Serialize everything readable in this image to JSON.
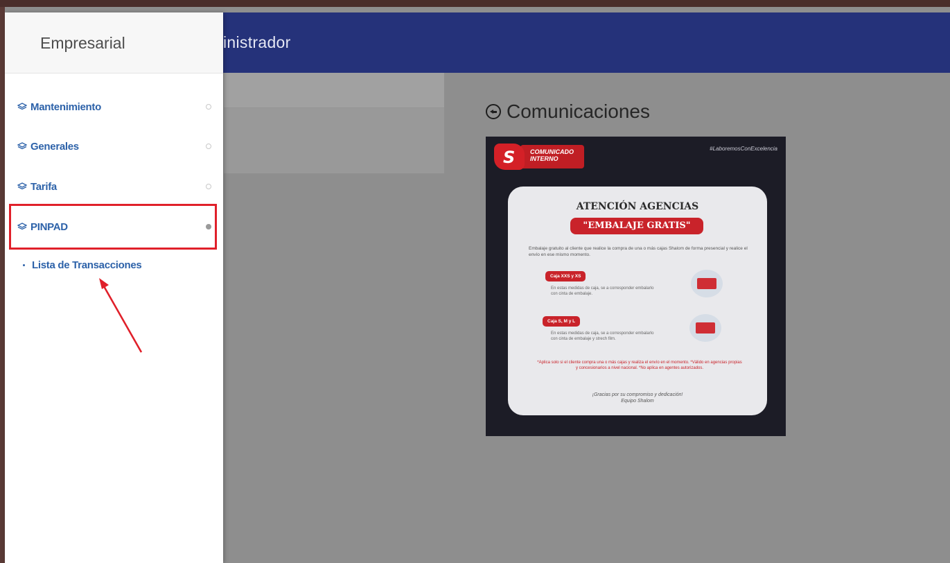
{
  "header": {
    "title": "inistrador"
  },
  "sidebar": {
    "brand": "Empresarial",
    "items": [
      {
        "label": "Mantenimiento",
        "icon": "layers-icon",
        "active": false
      },
      {
        "label": "Generales",
        "icon": "layers-icon",
        "active": false
      },
      {
        "label": "Tarifa",
        "icon": "layers-icon",
        "active": false
      },
      {
        "label": "PINPAD",
        "icon": "layers-icon",
        "active": true
      }
    ],
    "subitems": [
      {
        "label": "Lista de Transacciones"
      }
    ]
  },
  "main": {
    "section_title": "Comunicaciones",
    "back_icon": "circle-arrow-left-icon"
  },
  "poster": {
    "hashtag": "#LaboremosConExcelencia",
    "logo_letter": "S",
    "banner_line1": "COMUNICADO",
    "banner_line2": "INTERNO",
    "heading": "ATENCIÓN AGENCIAS",
    "pill": "\"EMBALAJE GRATIS\"",
    "intro": "Embalaje gratuito al cliente que realice la compra de una o más cajas Shalom de forma presencial y realice el envío en ese mismo momento.",
    "tag1": "Caja XXS y XS",
    "desc1": "En estas medidas de caja, se a corresponder embalarlo con cinta de embalaje.",
    "tag2": "Caja S, M y L",
    "desc2": "En estas medidas de caja, se a corresponder embalarlo con cinta de embalaje y strech film.",
    "note": "*Aplica solo si el cliente compra una o más cajas y realiza el envío en el momento. *Válido en agencias propias y concesionarios a nivel nacional. *No aplica en agentes autorizados.",
    "thanks1": "¡Gracias por su compromiso y dedicación!",
    "thanks2": "Equipo Shalom"
  },
  "colors": {
    "header": "#25327a",
    "accent_blue": "#2d62a9",
    "highlight_red": "#e0202a",
    "poster_red": "#c9232a"
  }
}
